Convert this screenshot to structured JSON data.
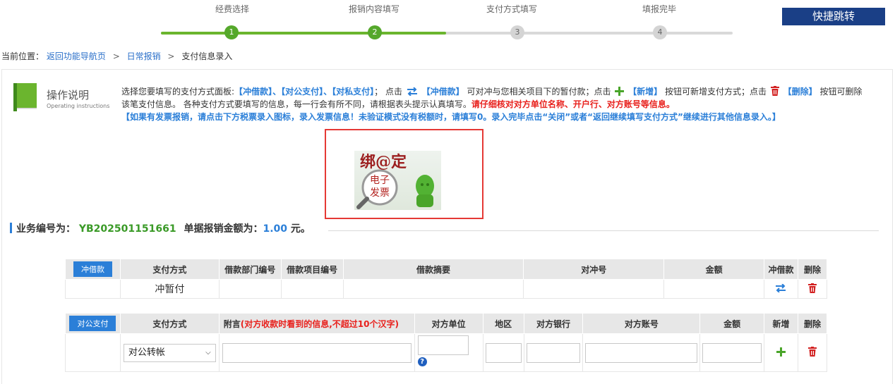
{
  "steps": [
    {
      "label": "经费选择",
      "num": "1",
      "done": true
    },
    {
      "label": "报销内容填写",
      "num": "2",
      "done": true
    },
    {
      "label": "支付方式填写",
      "num": "3",
      "done": false
    },
    {
      "label": "填报完毕",
      "num": "4",
      "done": false
    }
  ],
  "quick_jump": "快捷跳转",
  "breadcrumb": {
    "prefix": "当前位置：",
    "items": [
      "返回功能导航页",
      "日常报销",
      "支付信息录入"
    ],
    "sep": ">"
  },
  "instructions": {
    "title": "操作说明",
    "subtitle": "Operating instructions",
    "p1": "选择您要填写的支付方式面板:",
    "k_loan": "【冲借款】",
    "sep1": "、",
    "k_corp": "【对公支付】",
    "sep2": "、",
    "k_priv": "【对私支付】",
    "p2": "；  点击",
    "k_loan2": "【冲借款】",
    "p3": "可对冲与您相关项目下的暂付款；点击",
    "k_add": "【新增】",
    "p4": "按钮可新增支付方式；点击",
    "k_del": "【删除】",
    "p5": "按钮可删除该笔支付信息。 各种支付方式要填写的信息，每一行会有所不同，请根据表头提示认真填写。",
    "red_text": "请仔细核对对方单位名称、开户行、对方账号等信息。",
    "blue_text": "【如果有发票报销，请点击下方税票录入图标，录入发票信息！未验证模式没有税额时，请填写0。录入完毕点击“关闭”或者“返回继续填写支付方式”继续进行其他信息录入。】"
  },
  "einvoice": {
    "top_text": "绑@定",
    "line1": "电子",
    "line2": "发票"
  },
  "business": {
    "label": "业务编号为：",
    "number": "YB202501151661",
    "amount_label": "单据报销金额为：",
    "amount": "1.00",
    "unit": "元。"
  },
  "loan_table": {
    "badge": "冲借款",
    "headers": [
      "支付方式",
      "借款部门编号",
      "借款项目编号",
      "借款摘要",
      "对冲号",
      "金额",
      "冲借款",
      "删除"
    ],
    "row": {
      "method": "冲暂付"
    }
  },
  "corp_table": {
    "badge": "对公支付",
    "headers": {
      "method": "支付方式",
      "note": "附言",
      "note_hint": "(对方收款时看到的信息,不超过10个汉字)",
      "unit": "对方单位",
      "region": "地区",
      "bank": "对方银行",
      "account": "对方账号",
      "amount": "金额",
      "add": "新增",
      "del": "删除"
    },
    "row": {
      "method": "对公转帐"
    }
  },
  "colors": {
    "accent_blue": "#2b7fd8",
    "nav_blue": "#1a3f86",
    "step_green": "#55a82b",
    "alert_red": "#e8201c"
  },
  "icons": [
    "book-icon",
    "swap-icon",
    "plus-icon",
    "trash-icon",
    "help-icon",
    "chevron-down-icon"
  ]
}
